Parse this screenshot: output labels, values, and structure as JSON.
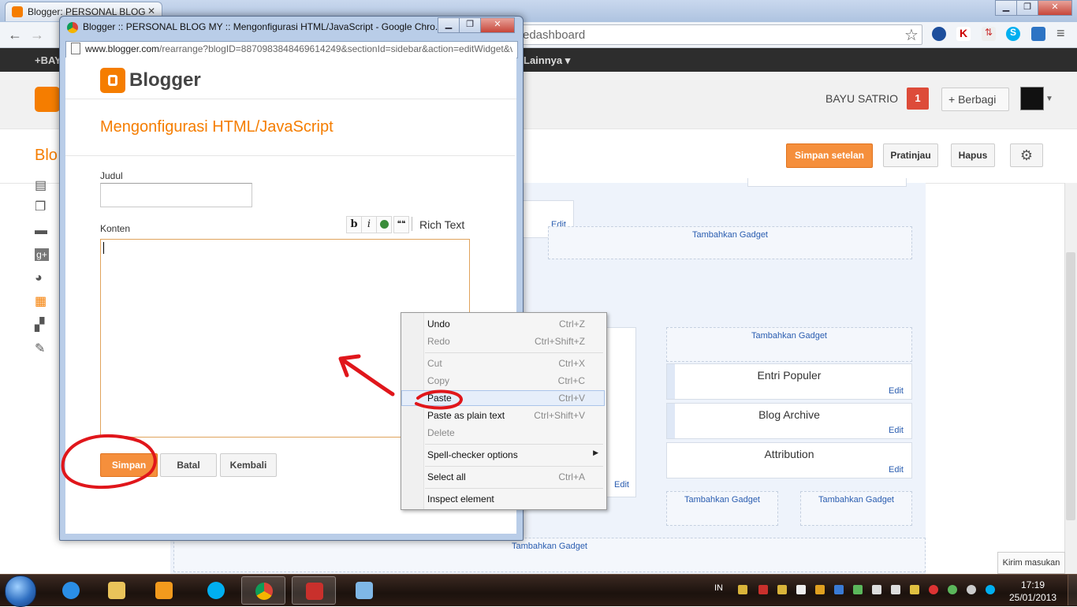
{
  "outer": {
    "tab_title": "Blogger: PERSONAL BLOG",
    "tab_close": "✕",
    "url_visible": "edashboard",
    "blogger_bar_left": "+BAY",
    "blogger_bar_more": "Lainnya ▾",
    "user_name": "BAYU SATRIO",
    "notification_count": "1",
    "share_label": "+ Berbagi",
    "blog_title_partial": "Blo",
    "buttons": {
      "save_settings": "Simpan setelan",
      "preview": "Pratinjau",
      "delete": "Hapus"
    },
    "feedback": "Kirim masukan"
  },
  "layout": {
    "add_gadget": "Tambahkan Gadget",
    "edit": "Edit",
    "gadgets": [
      "Entri Populer",
      "Blog Archive",
      "Attribution"
    ]
  },
  "popup": {
    "window_title": "Blogger :: PERSONAL BLOG MY :: Mengonfigurasi HTML/JavaScript - Google Chro...",
    "url_host": "www.blogger.com",
    "url_path": "/rearrange?blogID=8870983848469614249&sectionId=sidebar&action=editWidget&v",
    "logo_text": "Blogger",
    "page_title": "Mengonfigurasi HTML/JavaScript",
    "judul_label": "Judul",
    "judul_value": "",
    "konten_label": "Konten",
    "toolbar": {
      "bold": "b",
      "italic": "i",
      "quote": "❝❝",
      "rich_text": "Rich Text"
    },
    "buttons": {
      "save": "Simpan",
      "cancel": "Batal",
      "back": "Kembali"
    }
  },
  "context_menu": {
    "items": [
      {
        "label": "Undo",
        "shortcut": "Ctrl+Z"
      },
      {
        "label": "Redo",
        "shortcut": "Ctrl+Shift+Z"
      },
      {
        "label": "Cut",
        "shortcut": "Ctrl+X"
      },
      {
        "label": "Copy",
        "shortcut": "Ctrl+C"
      },
      {
        "label": "Paste",
        "shortcut": "Ctrl+V"
      },
      {
        "label": "Paste as plain text",
        "shortcut": "Ctrl+Shift+V"
      },
      {
        "label": "Delete",
        "shortcut": ""
      },
      {
        "label": "Spell-checker options",
        "shortcut": ""
      },
      {
        "label": "Select all",
        "shortcut": "Ctrl+A"
      },
      {
        "label": "Inspect element",
        "shortcut": ""
      }
    ]
  },
  "taskbar": {
    "language": "IN",
    "time": "17:19",
    "date": "25/01/2013"
  },
  "colors": {
    "blogger_orange": "#f57d00",
    "button_orange": "#f58f3c",
    "annotation_red": "#e0161b",
    "link_blue": "#2a5db0"
  }
}
